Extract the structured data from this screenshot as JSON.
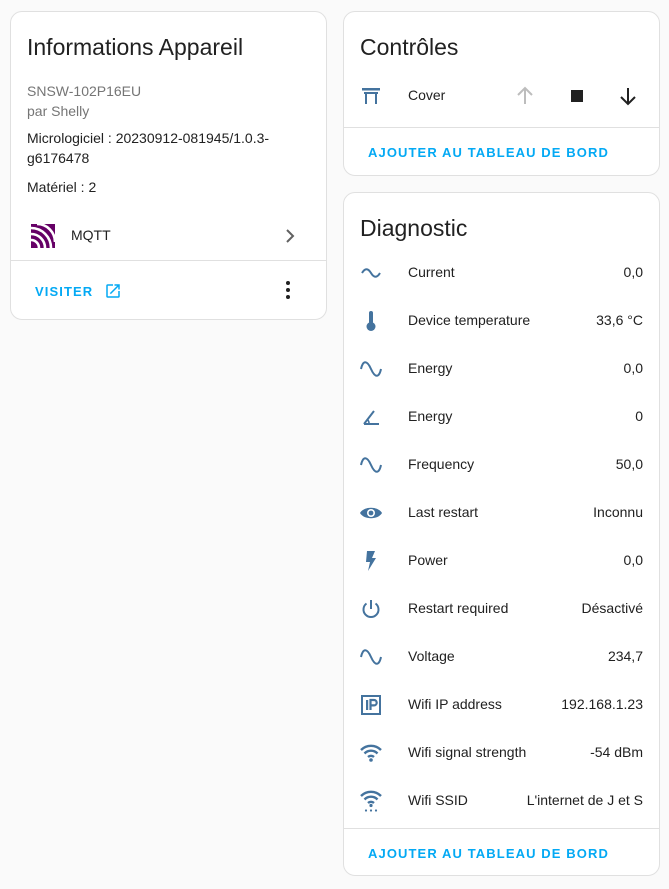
{
  "info_card": {
    "title": "Informations Appareil",
    "model": "SNSW-102P16EU",
    "manufacturer": "par Shelly",
    "firmware_line1": "Micrologiciel : 20230912-081945/1.0.3-",
    "firmware_line2": "g6176478",
    "hardware": "Matériel : 2",
    "integration": {
      "icon": "mqtt-icon",
      "label": "MQTT"
    },
    "visit_label": "VISITER"
  },
  "controls_card": {
    "title": "Contrôles",
    "entity": {
      "icon": "blinds-icon",
      "label": "Cover"
    },
    "add_label": "AJOUTER AU TABLEAU DE BORD"
  },
  "diagnostic_card": {
    "title": "Diagnostic",
    "items": [
      {
        "icon": "current-ac-icon",
        "label": "Current",
        "value": "0,0"
      },
      {
        "icon": "thermometer-icon",
        "label": "Device temperature",
        "value": "33,6 °C"
      },
      {
        "icon": "sine-wave-icon",
        "label": "Energy",
        "value": "0,0"
      },
      {
        "icon": "angle-acute-icon",
        "label": "Energy",
        "value": "0"
      },
      {
        "icon": "sine-wave-icon",
        "label": "Frequency",
        "value": "50,0"
      },
      {
        "icon": "eye-icon",
        "label": "Last restart",
        "value": "Inconnu"
      },
      {
        "icon": "flash-icon",
        "label": "Power",
        "value": "0,0"
      },
      {
        "icon": "power-icon",
        "label": "Restart required",
        "value": "Désactivé"
      },
      {
        "icon": "sine-wave-icon",
        "label": "Voltage",
        "value": "234,7"
      },
      {
        "icon": "ip-icon",
        "label": "Wifi IP address",
        "value": "192.168.1.23"
      },
      {
        "icon": "wifi-icon",
        "label": "Wifi signal strength",
        "value": "-54 dBm"
      },
      {
        "icon": "wifi-settings-icon",
        "label": "Wifi SSID",
        "value": "L'internet de J et S"
      }
    ],
    "add_label": "AJOUTER AU TABLEAU DE BORD"
  },
  "colors": {
    "accent": "#03a9f4",
    "icon": "#44739e",
    "mqtt": "#660066",
    "disabled": "#bdbdbd"
  }
}
